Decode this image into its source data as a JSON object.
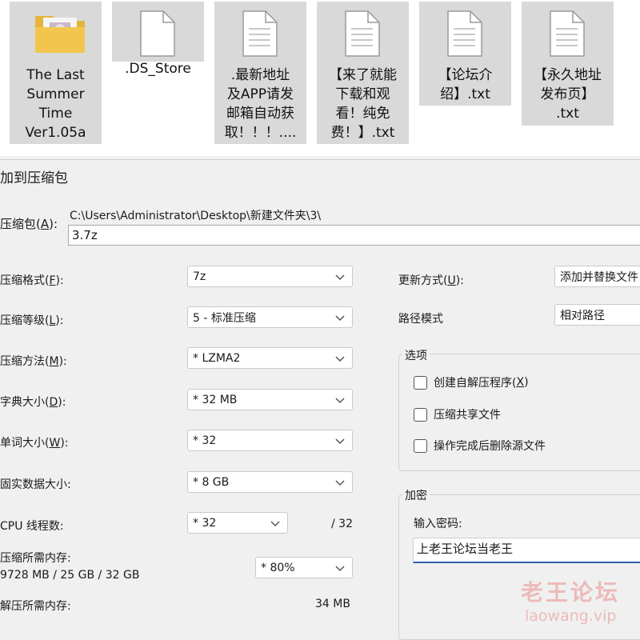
{
  "files": [
    {
      "name": "The Last\nSummer\nTime\nVer1.05a",
      "icon": "folder-icon"
    },
    {
      "name": ".DS_Store",
      "icon": "blank-file-icon"
    },
    {
      "name": ".最新地址\n及APP请发\n邮箱自动获\n取！！！....",
      "icon": "text-file-icon"
    },
    {
      "name": "【来了就能\n下载和观\n看！纯免\n费！】.txt",
      "icon": "text-file-icon"
    },
    {
      "name": "【论坛介\n绍】.txt",
      "icon": "text-file-icon"
    },
    {
      "name": "【永久地址\n发布页】\n.txt",
      "icon": "text-file-icon"
    }
  ],
  "dialog": {
    "title": "加到压缩包",
    "archive": {
      "label": "压缩包(",
      "hotkey": "A",
      "label_end": "):",
      "path": "C:\\Users\\Administrator\\Desktop\\新建文件夹\\3\\",
      "value": "3.7z"
    },
    "format": {
      "label": "压缩格式(",
      "hotkey": "F",
      "label_end": "):",
      "value": "7z"
    },
    "level": {
      "label": "压缩等级(",
      "hotkey": "L",
      "label_end": "):",
      "value": "5 - 标准压缩"
    },
    "method": {
      "label": "压缩方法(",
      "hotkey": "M",
      "label_end": "):",
      "value": "*  LZMA2"
    },
    "dict": {
      "label": "字典大小(",
      "hotkey": "D",
      "label_end": "):",
      "value": "*  32 MB"
    },
    "word": {
      "label": "单词大小(",
      "hotkey": "W",
      "label_end": "):",
      "value": "*  32"
    },
    "solid": {
      "label": "固实数据大小:",
      "value": "*  8 GB"
    },
    "cpu": {
      "label": "CPU 线程数:",
      "value": "*  32",
      "max": "/ 32"
    },
    "mem_compress": {
      "label": "压缩所需内存:",
      "detail": "9728 MB / 25 GB / 32 GB",
      "value": "*  80%"
    },
    "mem_decompress": {
      "label": "解压所需内存:",
      "value": "34 MB"
    },
    "update": {
      "label": "更新方式(",
      "hotkey": "U",
      "label_end": "):",
      "value": "添加并替换文件"
    },
    "path_mode": {
      "label": "路径模式",
      "value": "相对路径"
    },
    "options": {
      "title": "选项",
      "sfx": {
        "label": "创建自解压程序(",
        "hotkey": "X",
        "label_end": ")"
      },
      "shared": {
        "label": "压缩共享文件"
      },
      "delete": {
        "label": "操作完成后删除源文件"
      }
    },
    "encryption": {
      "title": "加密",
      "label": "输入密码:",
      "value": "上老王论坛当老王"
    }
  },
  "watermark": {
    "cn": "老王论坛",
    "url": "laowang.vip"
  }
}
